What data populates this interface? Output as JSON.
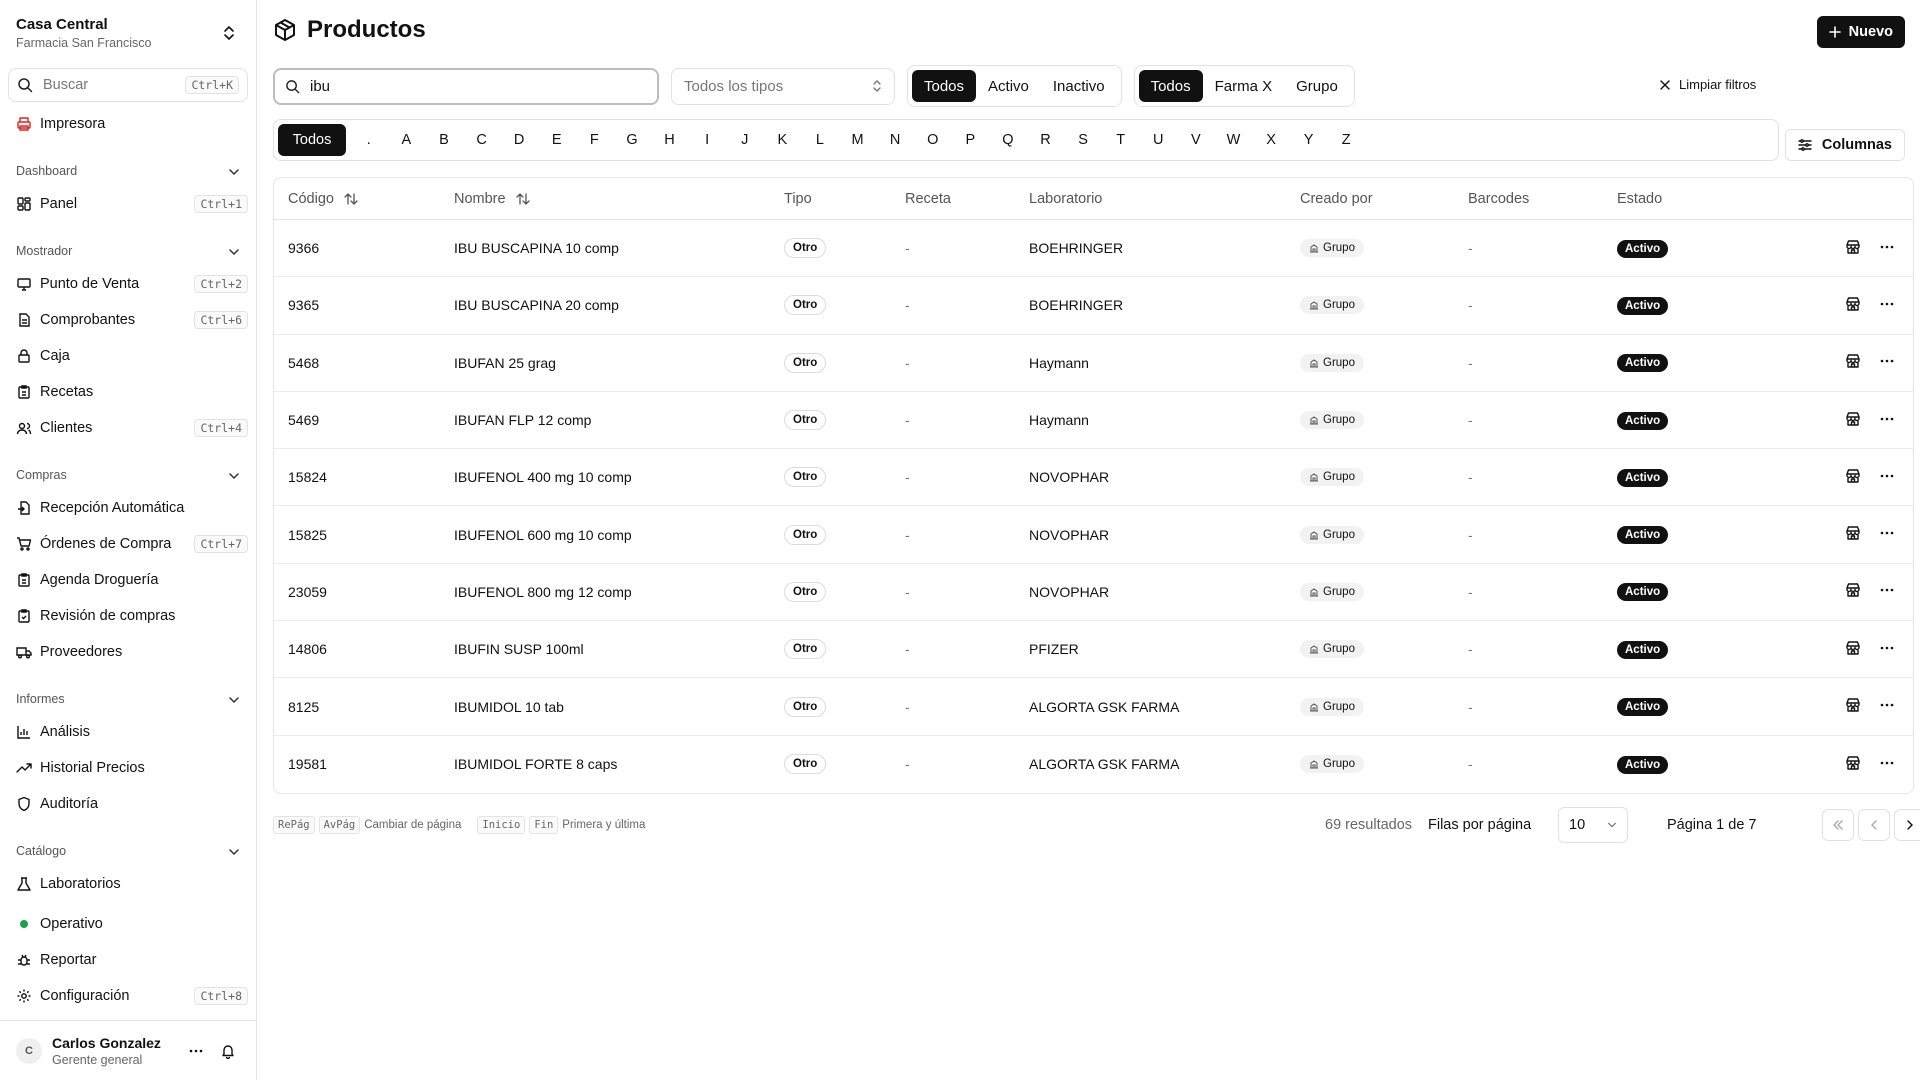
{
  "org": {
    "name": "Casa Central",
    "subtitle": "Farmacia San Francisco"
  },
  "search": {
    "label": "Buscar",
    "shortcut": "Ctrl+K"
  },
  "printer": {
    "label": "Impresora"
  },
  "sections": {
    "dashboard": {
      "title": "Dashboard",
      "items": [
        {
          "label": "Panel",
          "shortcut": "Ctrl+1"
        }
      ]
    },
    "mostrador": {
      "title": "Mostrador",
      "items": [
        {
          "label": "Punto de Venta",
          "shortcut": "Ctrl+2"
        },
        {
          "label": "Comprobantes",
          "shortcut": "Ctrl+6"
        },
        {
          "label": "Caja",
          "shortcut": ""
        },
        {
          "label": "Recetas",
          "shortcut": ""
        },
        {
          "label": "Clientes",
          "shortcut": "Ctrl+4"
        }
      ]
    },
    "compras": {
      "title": "Compras",
      "items": [
        {
          "label": "Recepción Automática",
          "shortcut": ""
        },
        {
          "label": "Órdenes de Compra",
          "shortcut": "Ctrl+7"
        },
        {
          "label": "Agenda Droguería",
          "shortcut": ""
        },
        {
          "label": "Revisión de compras",
          "shortcut": ""
        },
        {
          "label": "Proveedores",
          "shortcut": ""
        }
      ]
    },
    "informes": {
      "title": "Informes",
      "items": [
        {
          "label": "Análisis",
          "shortcut": ""
        },
        {
          "label": "Historial Precios",
          "shortcut": ""
        },
        {
          "label": "Auditoría",
          "shortcut": ""
        }
      ]
    },
    "catalogo": {
      "title": "Catálogo",
      "items": [
        {
          "label": "Laboratorios",
          "shortcut": ""
        }
      ]
    }
  },
  "bottom_nav": {
    "operativo": "Operativo",
    "reportar": "Reportar",
    "configuracion": {
      "label": "Configuración",
      "shortcut": "Ctrl+8"
    }
  },
  "user": {
    "initial": "C",
    "name": "Carlos Gonzalez",
    "role": "Gerente general"
  },
  "page": {
    "title": "Productos",
    "new_button": "Nuevo"
  },
  "filters": {
    "search_value": "ibu",
    "type_select": "Todos los tipos",
    "status": [
      "Todos",
      "Activo",
      "Inactivo"
    ],
    "status_active": 0,
    "scope": [
      "Todos",
      "Farma X",
      "Grupo"
    ],
    "scope_active": 0,
    "clear": "Limpiar filtros"
  },
  "letters": [
    "Todos",
    ".",
    "A",
    "B",
    "C",
    "D",
    "E",
    "F",
    "G",
    "H",
    "I",
    "J",
    "K",
    "L",
    "M",
    "N",
    "O",
    "P",
    "Q",
    "R",
    "S",
    "T",
    "U",
    "V",
    "W",
    "X",
    "Y",
    "Z"
  ],
  "columns_button": "Columnas",
  "table": {
    "headers": [
      "Código",
      "Nombre",
      "Tipo",
      "Receta",
      "Laboratorio",
      "Creado por",
      "Barcodes",
      "Estado"
    ],
    "rows": [
      {
        "code": "9366",
        "name": "IBU BUSCAPINA 10 comp",
        "type": "Otro",
        "receta": "-",
        "lab": "BOEHRINGER",
        "created_by": "Grupo",
        "barcodes": "-",
        "status": "Activo"
      },
      {
        "code": "9365",
        "name": "IBU BUSCAPINA 20 comp",
        "type": "Otro",
        "receta": "-",
        "lab": "BOEHRINGER",
        "created_by": "Grupo",
        "barcodes": "-",
        "status": "Activo"
      },
      {
        "code": "5468",
        "name": "IBUFAN 25 grag",
        "type": "Otro",
        "receta": "-",
        "lab": "Haymann",
        "created_by": "Grupo",
        "barcodes": "-",
        "status": "Activo"
      },
      {
        "code": "5469",
        "name": "IBUFAN FLP 12 comp",
        "type": "Otro",
        "receta": "-",
        "lab": "Haymann",
        "created_by": "Grupo",
        "barcodes": "-",
        "status": "Activo"
      },
      {
        "code": "15824",
        "name": "IBUFENOL 400 mg 10 comp",
        "type": "Otro",
        "receta": "-",
        "lab": "NOVOPHAR",
        "created_by": "Grupo",
        "barcodes": "-",
        "status": "Activo"
      },
      {
        "code": "15825",
        "name": "IBUFENOL 600 mg 10 comp",
        "type": "Otro",
        "receta": "-",
        "lab": "NOVOPHAR",
        "created_by": "Grupo",
        "barcodes": "-",
        "status": "Activo"
      },
      {
        "code": "23059",
        "name": "IBUFENOL 800 mg 12 comp",
        "type": "Otro",
        "receta": "-",
        "lab": "NOVOPHAR",
        "created_by": "Grupo",
        "barcodes": "-",
        "status": "Activo"
      },
      {
        "code": "14806",
        "name": "IBUFIN SUSP 100ml",
        "type": "Otro",
        "receta": "-",
        "lab": "PFIZER",
        "created_by": "Grupo",
        "barcodes": "-",
        "status": "Activo"
      },
      {
        "code": "8125",
        "name": "IBUMIDOL 10 tab",
        "type": "Otro",
        "receta": "-",
        "lab": "ALGORTA GSK FARMA",
        "created_by": "Grupo",
        "barcodes": "-",
        "status": "Activo"
      },
      {
        "code": "19581",
        "name": "IBUMIDOL FORTE 8 caps",
        "type": "Otro",
        "receta": "-",
        "lab": "ALGORTA GSK FARMA",
        "created_by": "Grupo",
        "barcodes": "-",
        "status": "Activo"
      }
    ]
  },
  "footer": {
    "hint1_keys": [
      "RePág",
      "AvPág"
    ],
    "hint1_text": "Cambiar de página",
    "hint2_keys": [
      "Inicio",
      "Fin"
    ],
    "hint2_text": "Primera y última",
    "results": "69 resultados",
    "rows_label": "Filas por página",
    "rows_value": "10",
    "page_label": "Página 1 de 7"
  },
  "icons": {
    "brand_accent": "#111111",
    "printer_color": "#dc2626",
    "status_dot": "#16a34a"
  }
}
